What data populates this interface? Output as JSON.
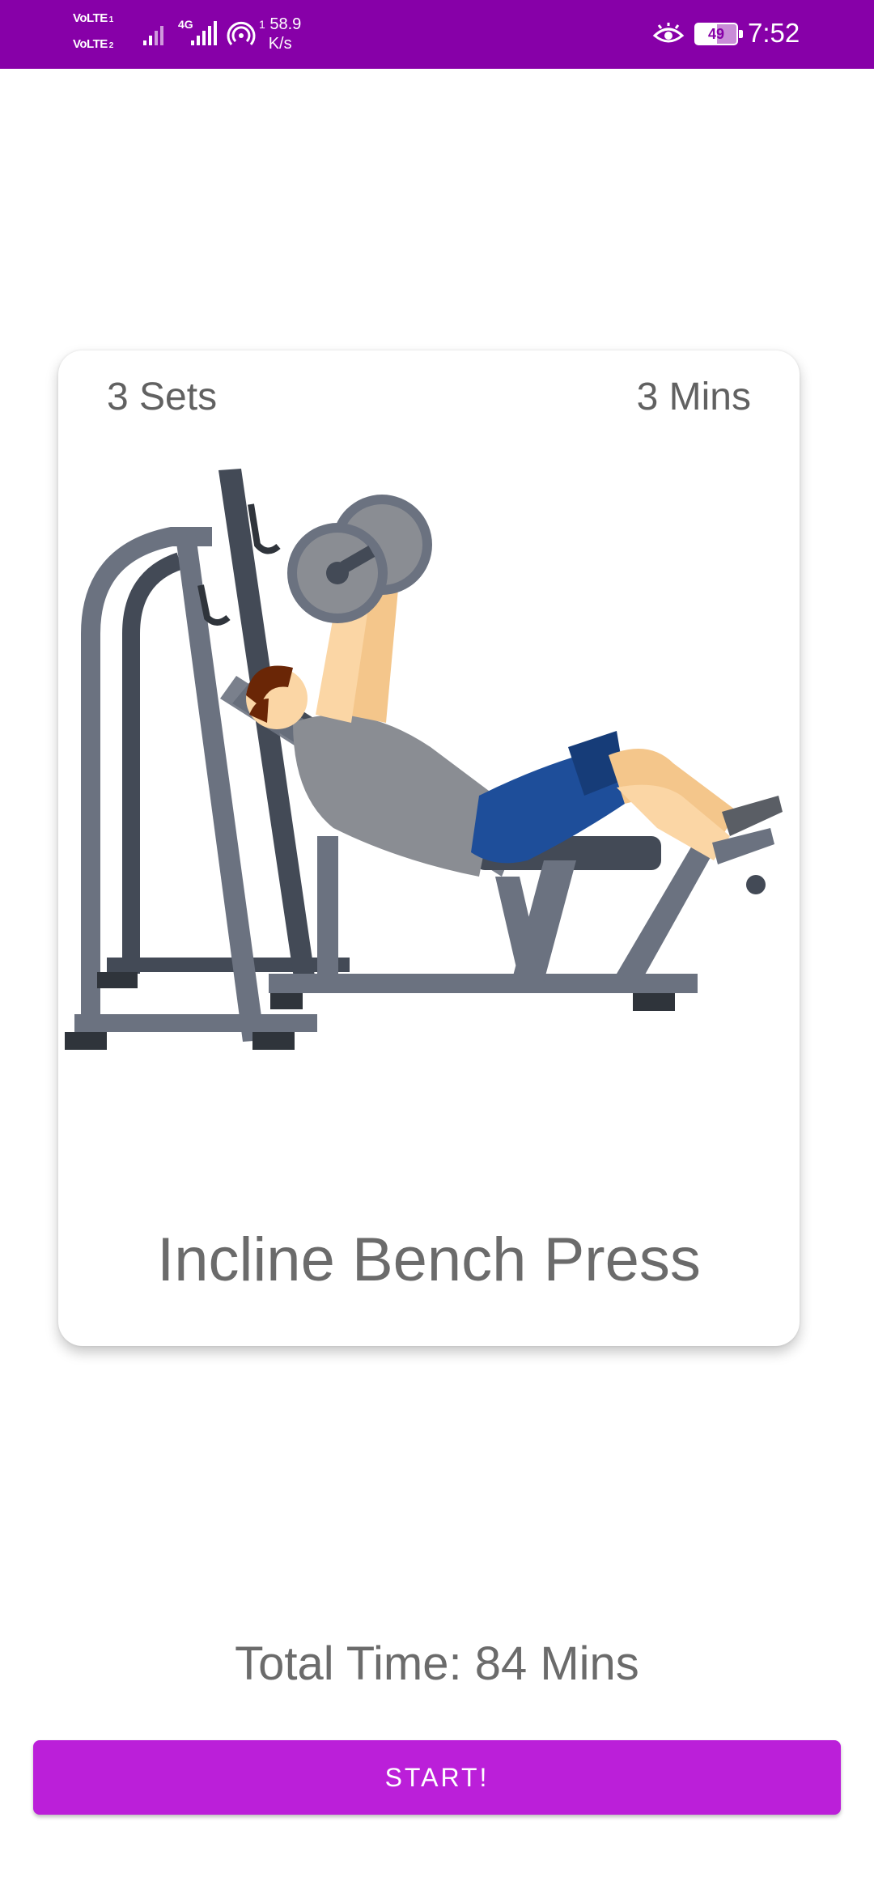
{
  "status_bar": {
    "volte_1": "VoLTE",
    "volte_1_sub": "1",
    "volte_2": "VoLTE",
    "volte_2_sub": "2",
    "network": "4G",
    "speed_value": "58.9",
    "speed_prefix": "1",
    "speed_unit": "K/s",
    "battery": "49",
    "time": "7:52"
  },
  "exercise_card": {
    "sets": "3 Sets",
    "duration": "3 Mins",
    "title": "Incline Bench Press",
    "illustration_icon": "incline-bench-press-illustration"
  },
  "summary": {
    "total_time": "Total Time: 84 Mins"
  },
  "actions": {
    "start_label": "START!"
  },
  "colors": {
    "status_bar": "#8700a8",
    "accent": "#bb1fd9",
    "text_gray": "#6b6b6b"
  }
}
